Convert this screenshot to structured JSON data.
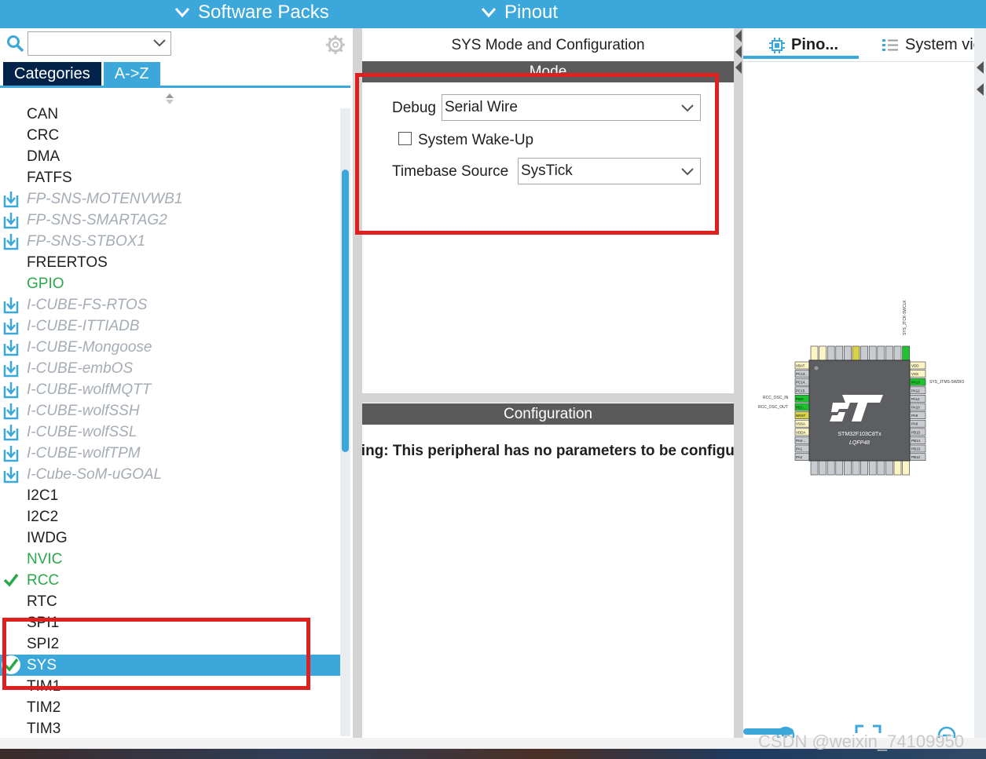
{
  "top_menu": {
    "software_packs": "Software Packs",
    "pinout": "Pinout"
  },
  "left_panel": {
    "tabs": {
      "categories": "Categories",
      "az": "A->Z"
    },
    "items": [
      {
        "label": "CAN",
        "style": "normal"
      },
      {
        "label": "CRC",
        "style": "normal"
      },
      {
        "label": "DMA",
        "style": "normal"
      },
      {
        "label": "FATFS",
        "style": "normal"
      },
      {
        "label": "FP-SNS-MOTENVWB1",
        "style": "pack"
      },
      {
        "label": "FP-SNS-SMARTAG2",
        "style": "pack"
      },
      {
        "label": "FP-SNS-STBOX1",
        "style": "pack"
      },
      {
        "label": "FREERTOS",
        "style": "normal"
      },
      {
        "label": "GPIO",
        "style": "green"
      },
      {
        "label": "I-CUBE-FS-RTOS",
        "style": "pack"
      },
      {
        "label": "I-CUBE-ITTIADB",
        "style": "pack"
      },
      {
        "label": "I-CUBE-Mongoose",
        "style": "pack"
      },
      {
        "label": "I-CUBE-embOS",
        "style": "pack"
      },
      {
        "label": "I-CUBE-wolfMQTT",
        "style": "pack"
      },
      {
        "label": "I-CUBE-wolfSSH",
        "style": "pack"
      },
      {
        "label": "I-CUBE-wolfSSL",
        "style": "pack"
      },
      {
        "label": "I-CUBE-wolfTPM",
        "style": "pack"
      },
      {
        "label": "I-Cube-SoM-uGOAL",
        "style": "pack"
      },
      {
        "label": "I2C1",
        "style": "normal"
      },
      {
        "label": "I2C2",
        "style": "normal"
      },
      {
        "label": "IWDG",
        "style": "normal"
      },
      {
        "label": "NVIC",
        "style": "green"
      },
      {
        "label": "RCC",
        "style": "green-check"
      },
      {
        "label": "RTC",
        "style": "normal"
      },
      {
        "label": "SPI1",
        "style": "normal"
      },
      {
        "label": "SPI2",
        "style": "normal"
      },
      {
        "label": "SYS",
        "style": "selected-check"
      },
      {
        "label": "TIM1",
        "style": "normal"
      },
      {
        "label": "TIM2",
        "style": "normal"
      },
      {
        "label": "TIM3",
        "style": "normal"
      }
    ]
  },
  "middle_panel": {
    "title": "SYS Mode and Configuration",
    "mode_header": "Mode",
    "debug_label": "Debug",
    "debug_value": "Serial Wire",
    "wakeup_label": "System Wake-Up",
    "wakeup_checked": false,
    "timebase_label": "Timebase Source",
    "timebase_value": "SysTick",
    "config_header": "Configuration",
    "warning": "Warning: This peripheral has no parameters to be configured."
  },
  "right_panel": {
    "tab_pinout": "Pino...",
    "tab_system": "System view",
    "chip": {
      "part": "STM32F103C8Tx",
      "package": "LQFP48",
      "label_top": "SYS_JTCK-SWCLK",
      "label_right": "SYS_JTMS-SWDIO",
      "label_osc_in": "RCC_OSC_IN",
      "label_osc_out": "RCC_OSC_OUT",
      "left_pins": [
        "VBAT",
        "PC13..",
        "PC14..",
        "PC15..",
        "PD0-..",
        "PD1-..",
        "NRST",
        "VSSA",
        "VDDA",
        "PA0-..",
        "PA1",
        "PA2"
      ],
      "right_pins": [
        "VDD",
        "VSS",
        "PA13",
        "PA12",
        "PA11",
        "PA10",
        "PA9",
        "PA8",
        "PB15",
        "PB14",
        "PB13",
        "PB12"
      ]
    }
  },
  "watermark": "CSDN @weixin_74109950",
  "colors": {
    "accent": "#3ca7db",
    "navy": "#03234b",
    "header_gray": "#5a5a5a",
    "green": "#2aa84a",
    "annotation_red": "#e0201f"
  }
}
